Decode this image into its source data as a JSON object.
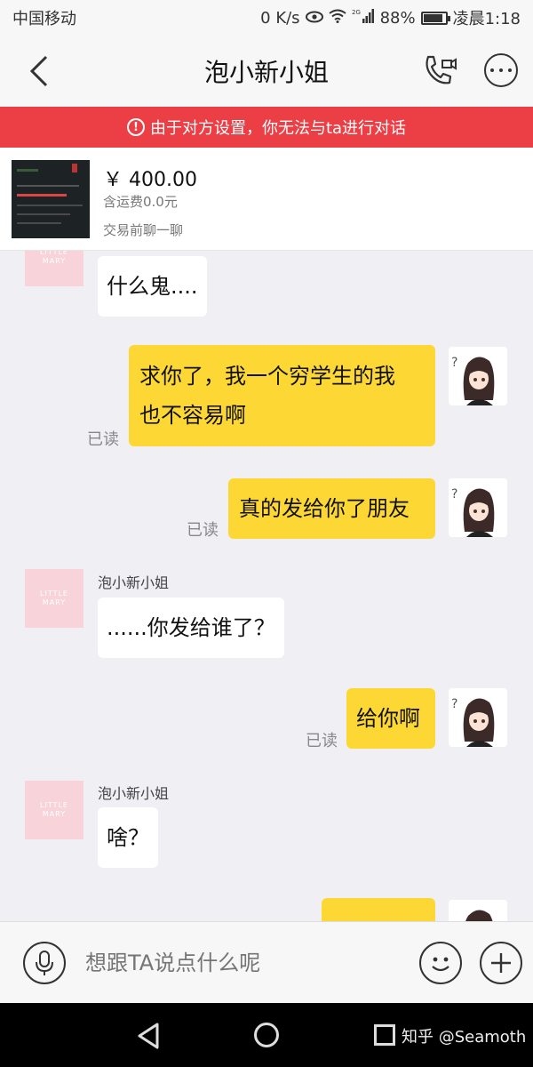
{
  "status_bar": {
    "carrier": "中国移动",
    "speed": "0 K/s",
    "network": "2G",
    "battery": "88%",
    "battery_level": 0.88,
    "time": "凌晨1:18"
  },
  "header": {
    "title": "泡小新小姐",
    "icons": [
      "back-arrow-icon",
      "video-call-icon",
      "more-icon"
    ]
  },
  "banner": {
    "text": "由于对方设置，你无法与ta进行对话"
  },
  "product": {
    "price": "￥ 400.00",
    "shipping": "含运费0.0元",
    "hint": "交易前聊一聊"
  },
  "messages": [
    {
      "from": "other",
      "text": "什么鬼...."
    },
    {
      "from": "me",
      "lines": [
        "求你了，我一个穷学生的我",
        "也不容易啊"
      ],
      "status": "已读"
    },
    {
      "from": "me",
      "text": "真的发给你了朋友",
      "status": "已读"
    },
    {
      "from": "other",
      "sender": "泡小新小姐",
      "text": "......你发给谁了？"
    },
    {
      "from": "me",
      "text": "给你啊",
      "status": "已读"
    },
    {
      "from": "other",
      "sender": "泡小新小姐",
      "text": "啥？"
    }
  ],
  "input": {
    "placeholder": "想跟TA说点什么呢"
  },
  "watermark": "知乎 @Seamoth",
  "colors": {
    "banner": "#ec3f45",
    "my_bubble": "#fdd835",
    "background": "#efeff4"
  }
}
